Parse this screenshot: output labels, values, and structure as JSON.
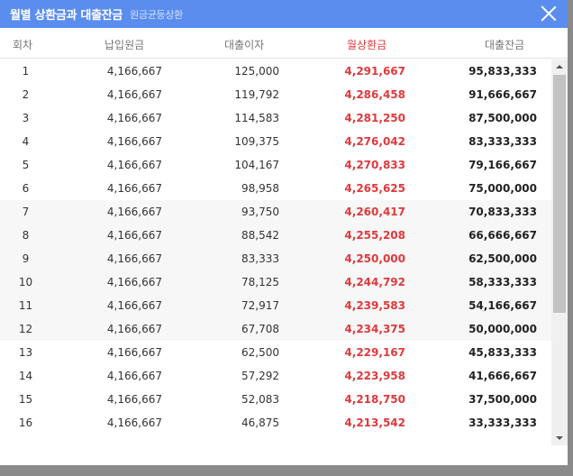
{
  "modal": {
    "title": "월별 상환금과 대출잔금",
    "subtitle": "원금균등상환"
  },
  "columns": {
    "round": "회차",
    "principal": "납입원금",
    "interest": "대출이자",
    "payment": "월상환금",
    "balance": "대출잔금"
  },
  "rows": [
    {
      "round": "1",
      "principal": "4,166,667",
      "interest": "125,000",
      "payment": "4,291,667",
      "balance": "95,833,333"
    },
    {
      "round": "2",
      "principal": "4,166,667",
      "interest": "119,792",
      "payment": "4,286,458",
      "balance": "91,666,667"
    },
    {
      "round": "3",
      "principal": "4,166,667",
      "interest": "114,583",
      "payment": "4,281,250",
      "balance": "87,500,000"
    },
    {
      "round": "4",
      "principal": "4,166,667",
      "interest": "109,375",
      "payment": "4,276,042",
      "balance": "83,333,333"
    },
    {
      "round": "5",
      "principal": "4,166,667",
      "interest": "104,167",
      "payment": "4,270,833",
      "balance": "79,166,667"
    },
    {
      "round": "6",
      "principal": "4,166,667",
      "interest": "98,958",
      "payment": "4,265,625",
      "balance": "75,000,000"
    },
    {
      "round": "7",
      "principal": "4,166,667",
      "interest": "93,750",
      "payment": "4,260,417",
      "balance": "70,833,333"
    },
    {
      "round": "8",
      "principal": "4,166,667",
      "interest": "88,542",
      "payment": "4,255,208",
      "balance": "66,666,667"
    },
    {
      "round": "9",
      "principal": "4,166,667",
      "interest": "83,333",
      "payment": "4,250,000",
      "balance": "62,500,000"
    },
    {
      "round": "10",
      "principal": "4,166,667",
      "interest": "78,125",
      "payment": "4,244,792",
      "balance": "58,333,333"
    },
    {
      "round": "11",
      "principal": "4,166,667",
      "interest": "72,917",
      "payment": "4,239,583",
      "balance": "54,166,667"
    },
    {
      "round": "12",
      "principal": "4,166,667",
      "interest": "67,708",
      "payment": "4,234,375",
      "balance": "50,000,000"
    },
    {
      "round": "13",
      "principal": "4,166,667",
      "interest": "62,500",
      "payment": "4,229,167",
      "balance": "45,833,333"
    },
    {
      "round": "14",
      "principal": "4,166,667",
      "interest": "57,292",
      "payment": "4,223,958",
      "balance": "41,666,667"
    },
    {
      "round": "15",
      "principal": "4,166,667",
      "interest": "52,083",
      "payment": "4,218,750",
      "balance": "37,500,000"
    },
    {
      "round": "16",
      "principal": "4,166,667",
      "interest": "46,875",
      "payment": "4,213,542",
      "balance": "33,333,333"
    }
  ],
  "colors": {
    "titlebar": "#5b8def",
    "accent_red": "#e0393c",
    "row_shade": "#f7f7f7"
  },
  "icons": {
    "close": "close-icon"
  }
}
